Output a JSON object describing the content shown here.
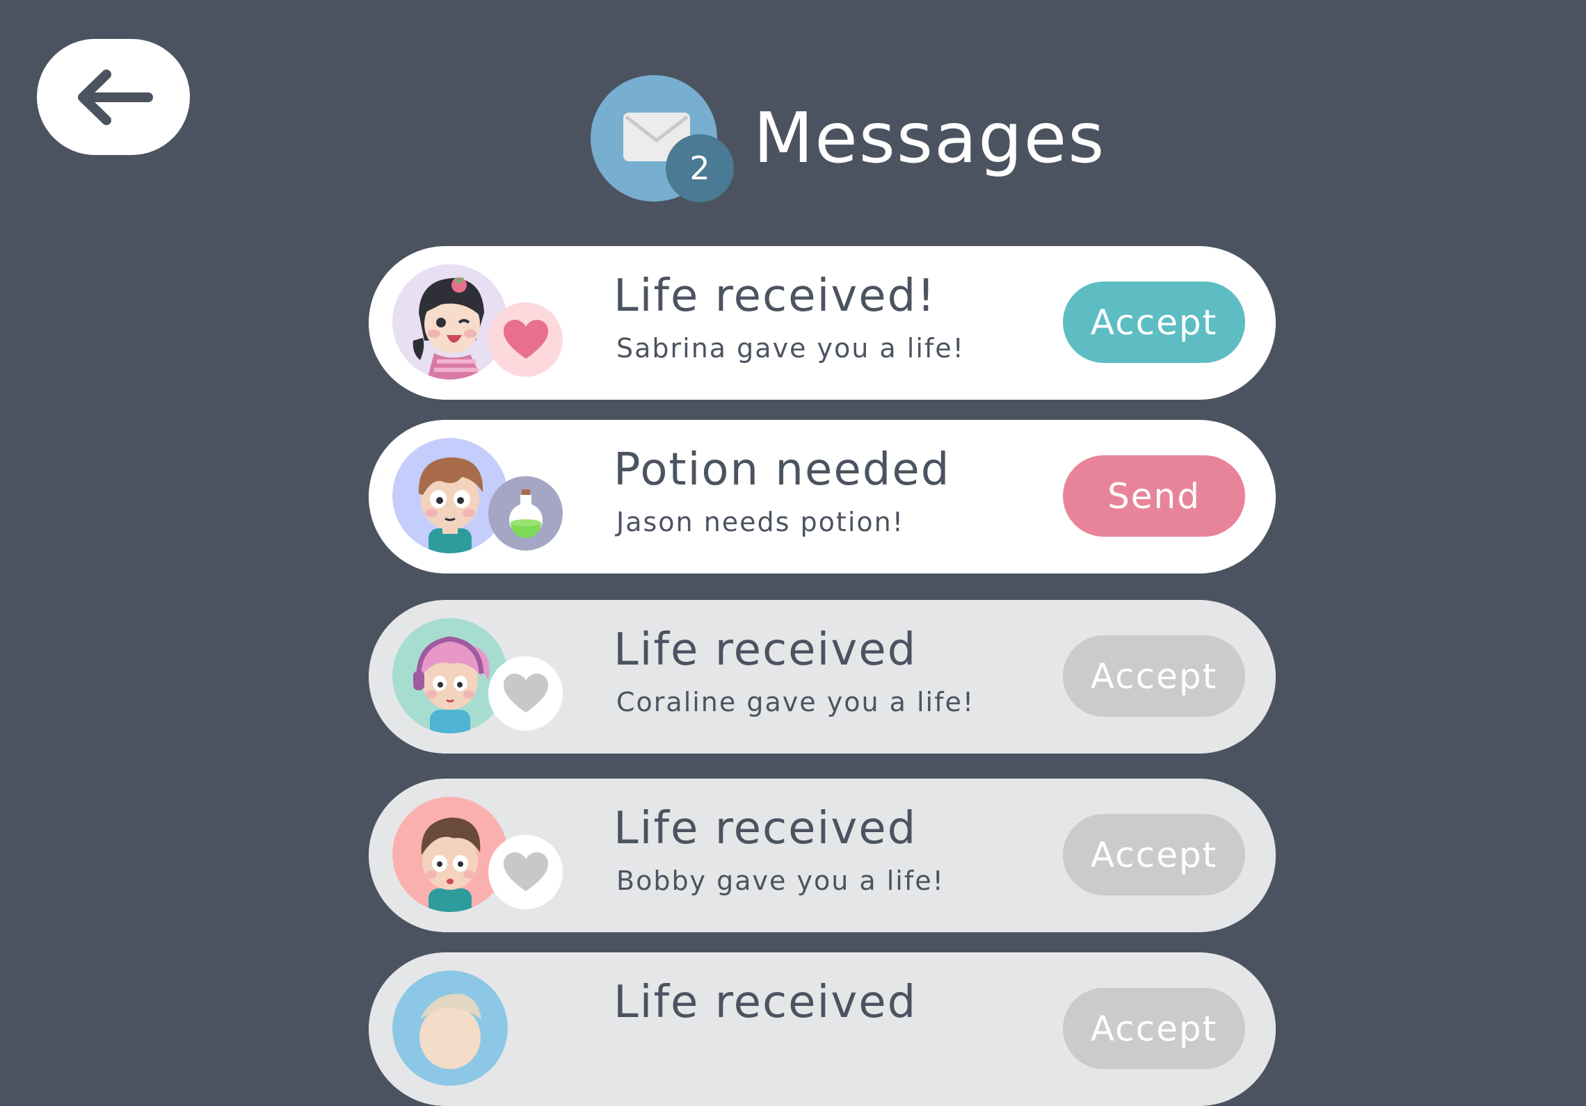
{
  "header": {
    "title": "Messages",
    "unread_count": "2"
  },
  "messages": [
    {
      "title": "Life received!",
      "subtitle": "Sabrina gave you a life!",
      "action": "Accept",
      "badge": "heart-icon",
      "state": "active"
    },
    {
      "title": "Potion needed",
      "subtitle": "Jason needs potion!",
      "action": "Send",
      "badge": "potion-icon",
      "state": "active"
    },
    {
      "title": "Life received",
      "subtitle": "Coraline gave you a life!",
      "action": "Accept",
      "badge": "heart-icon",
      "state": "inactive"
    },
    {
      "title": "Life received",
      "subtitle": "Bobby gave you a life!",
      "action": "Accept",
      "badge": "heart-icon",
      "state": "inactive"
    },
    {
      "title": "Life received",
      "subtitle": "",
      "action": "Accept",
      "badge": "heart-icon",
      "state": "inactive"
    }
  ],
  "colors": {
    "background": "#4c5360",
    "accept_active": "#5dbdc3",
    "send_active": "#e8849a",
    "button_inactive": "#cacbcd",
    "heart_active": "#e8708d",
    "heart_inactive": "#c7c8ca",
    "mail_circle": "#78aecf",
    "mail_badge": "#4a7a94"
  }
}
